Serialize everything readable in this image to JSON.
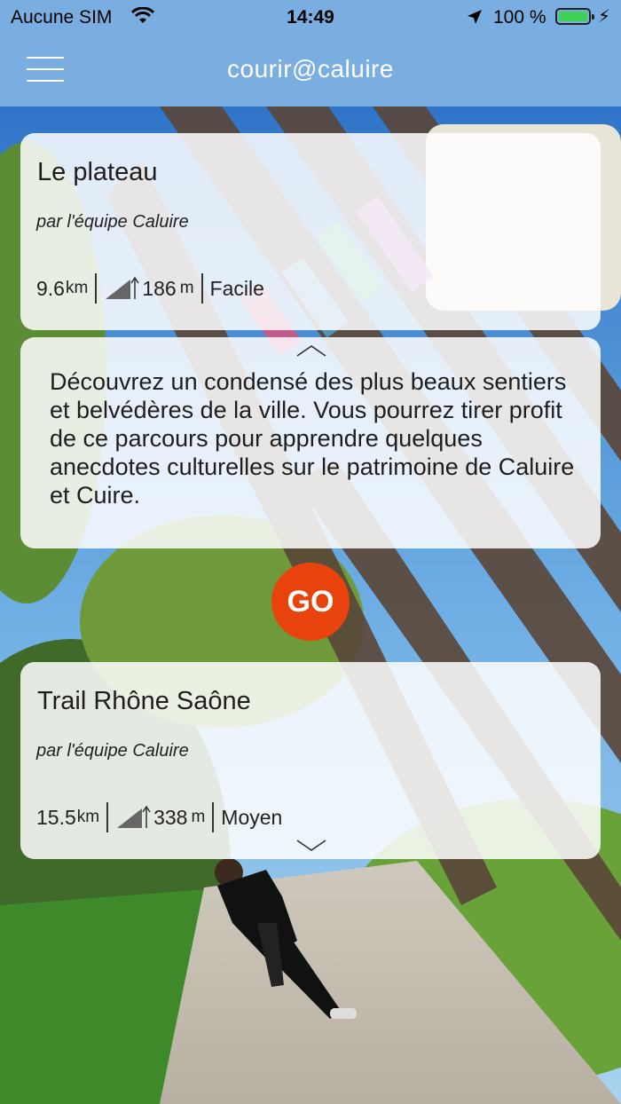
{
  "status_bar": {
    "carrier": "Aucune SIM",
    "time": "14:49",
    "battery_pct": "100 %",
    "icons": [
      "wifi-icon",
      "location-arrow-icon",
      "battery-icon",
      "charging-bolt-icon"
    ]
  },
  "nav": {
    "title": "courir@caluire",
    "menu_icon": "hamburger-menu-icon"
  },
  "routes": [
    {
      "title": "Le plateau",
      "author": "par l'équipe Caluire",
      "distance": "9.6",
      "distance_unit": "km",
      "elevation": "186",
      "elevation_unit": "m",
      "difficulty": "Facile",
      "description": "Découvrez un condensé des plus beaux sentiers et belvédères de la ville. Vous pourrez tirer profit de ce parcours pour apprendre quelques anecdotes culturelles sur le patrimoine de Caluire et Cuire."
    },
    {
      "title": "Trail Rhône Saône",
      "author": "par l'équipe Caluire",
      "distance": "15.5",
      "distance_unit": "km",
      "elevation": "338",
      "elevation_unit": "m",
      "difficulty": "Moyen"
    }
  ],
  "go_button": "GO",
  "colors": {
    "header": "#7aaee0",
    "go": "#e9430d",
    "battery": "#3ed255"
  }
}
